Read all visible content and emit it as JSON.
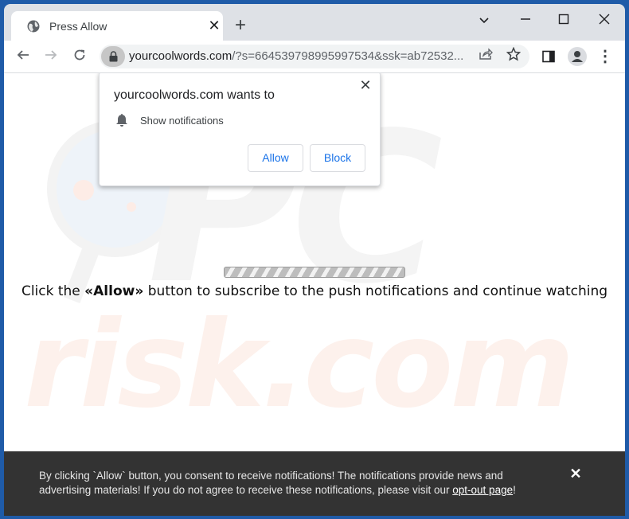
{
  "browser": {
    "tab": {
      "title": "Press Allow",
      "icon": "globe-icon"
    },
    "new_tab_label": "+",
    "window_controls": {
      "tab_search": "⌄",
      "minimize": "—",
      "maximize": "☐",
      "close": "✕"
    },
    "nav": {
      "back": "←",
      "forward": "→",
      "reload": "↻"
    },
    "address": {
      "domain": "yourcoolwords.com",
      "path": "/?s=664539798995997534&ssk=ab72532..."
    },
    "menu_label": "⋮"
  },
  "permission_popup": {
    "title": "yourcoolwords.com wants to",
    "permission": "Show notifications",
    "allow_label": "Allow",
    "block_label": "Block",
    "close_label": "✕"
  },
  "page": {
    "progress_percent": 100,
    "message_before": "Click the ",
    "message_bold": "«Allow»",
    "message_after": " button to subscribe to the push notifications and continue watching",
    "watermark_top": "PC",
    "watermark_bottom": "risk.com"
  },
  "banner": {
    "text": "By clicking `Allow` button, you consent to receive notifications! The notifications provide news and advertising materials! If you do not agree to receive these notifications, please visit our ",
    "link_label": "opt-out page",
    "text_end": "!",
    "close_label": "✕"
  },
  "colors": {
    "desktop": "#1f5ba8",
    "accent": "#1a73e8",
    "banner_bg": "#333333"
  }
}
